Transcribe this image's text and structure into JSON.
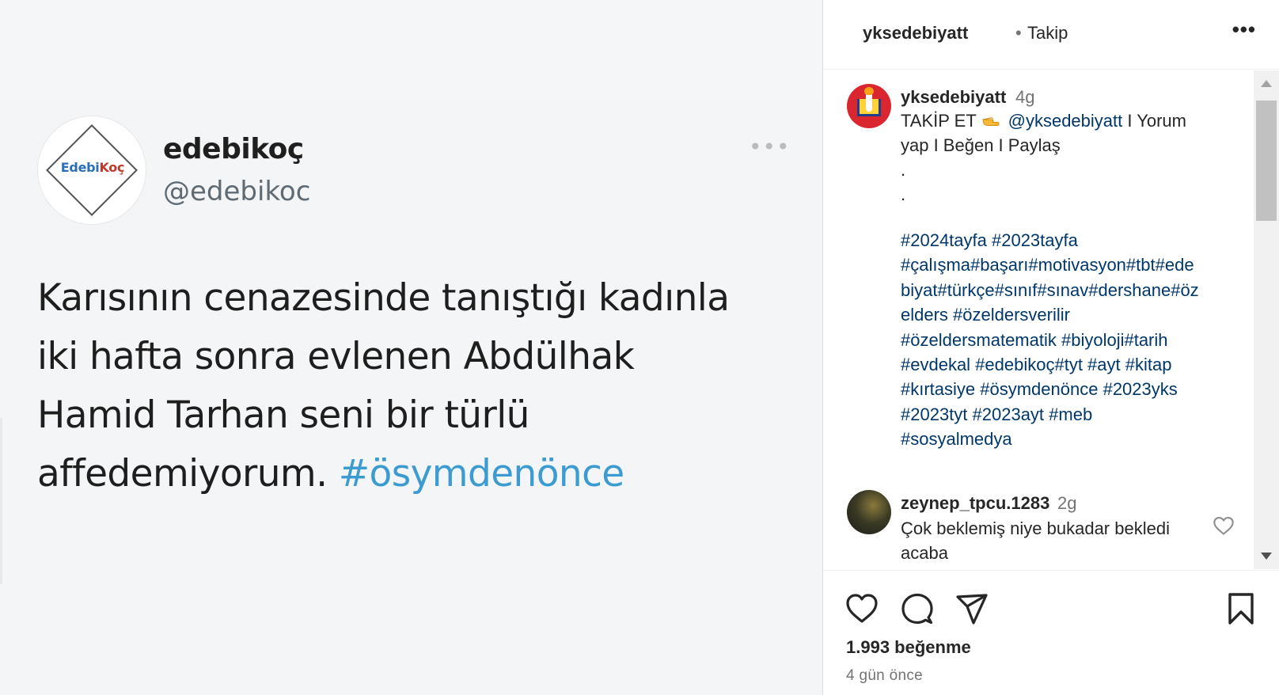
{
  "tweet": {
    "logo_left": "Edebi",
    "logo_right": "Koç",
    "name": "edebikoç",
    "handle": "@edebikoc",
    "more": "•••",
    "body_lines": [
      "Karısının cenazesinde tanıştığı kadınla",
      "iki hafta sonra evlenen Abdülhak",
      "Hamid Tarhan seni bir türlü",
      "affedemiyorum."
    ],
    "body_tag": "#ösymdenönce"
  },
  "header": {
    "username": "yksedebiyatt",
    "separator": "•",
    "follow_label": "Takip",
    "more_label": "•••"
  },
  "caption": {
    "username": "yksedebiyatt",
    "time": "4g",
    "line1_prefix": "TAKİP ET",
    "mention": "@yksedebiyatt",
    "line1_suffix": "I Yorum",
    "line2": "yap I Beğen I Paylaş",
    "dot1": ".",
    "dot2": ".",
    "hashtags": "#2024tayfa #2023tayfa #çalışma#başarı#motivasyon#tbt#edebiyat#türkçe#sınıf#sınav#dershane#özelders #özeldersverilir #özeldersmatematik #biyoloji#tarih #evdekal #edebikoç#tyt #ayt #kitap #kırtasiye #ösymdenönce #2023yks #2023tyt #2023ayt #meb #sosyalmedya",
    "hashtag_lines": [
      "#2024tayfa #2023tayfa",
      "#çalışma#başarı#motivasyon#tbt#ede",
      "biyat#türkçe#sınıf#sınav#dershane#öz",
      "elders #özeldersverilir",
      "#özeldersmatematik #biyoloji#tarih",
      "#evdekal #edebikoç#tyt #ayt #kitap",
      "#kırtasiye #ösymdenönce #2023yks",
      "#2023tyt #2023ayt #meb",
      "#sosyalmedya"
    ]
  },
  "comment": {
    "username": "zeynep_tpcu.1283",
    "time": "2g",
    "line1": "Çok beklemiş niye bukadar bekledi",
    "line2": "acaba"
  },
  "footer": {
    "likes": "1.993 beğenme",
    "ago": "4 gün önce"
  },
  "colors": {
    "link": "#00376b",
    "tweet_tag": "#3c9bd0",
    "muted": "#737373",
    "owner_avatar": "#d9262f"
  }
}
